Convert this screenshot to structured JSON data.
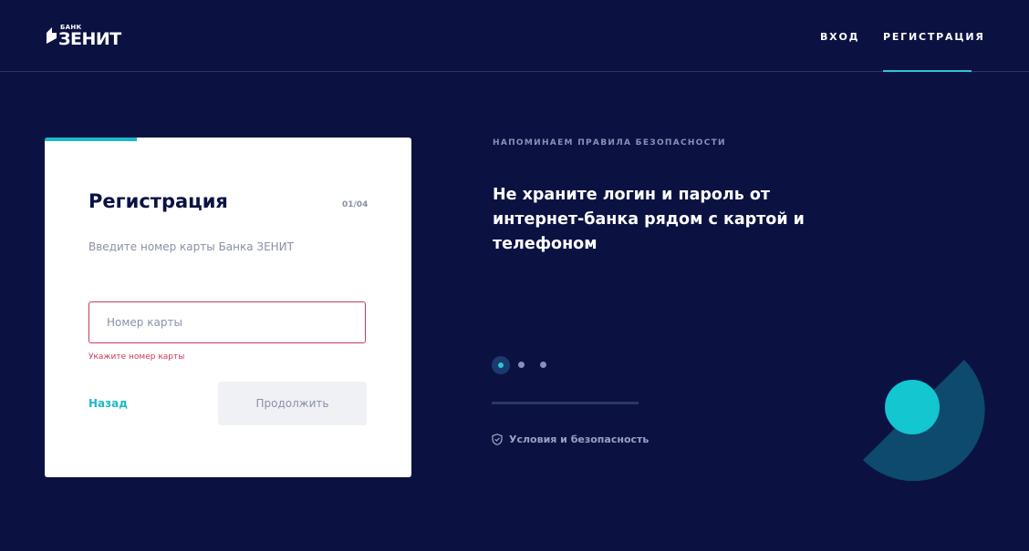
{
  "header": {
    "logo": {
      "small": "БАНК",
      "big": "ЗЕНИТ"
    },
    "nav": {
      "login": "ВХОД",
      "register": "РЕГИСТРАЦИЯ"
    }
  },
  "card": {
    "title": "Регистрация",
    "step": "01/04",
    "subtitle": "Введите номер карты Банка ЗЕНИТ",
    "input": {
      "placeholder": "Номер карты",
      "value": ""
    },
    "error": "Укажите номер карты",
    "back_label": "Назад",
    "continue_label": "Продолжить"
  },
  "side": {
    "label": "НАПОМИНАЕМ ПРАВИЛА БЕЗОПАСНОСТИ",
    "text": "Не храните логин и пароль от интернет-банка рядом с картой и телефоном",
    "terms_label": "Условия и безопасность"
  },
  "colors": {
    "background": "#0b1242",
    "accent": "#1fb8c8",
    "error": "#c73b5a"
  }
}
